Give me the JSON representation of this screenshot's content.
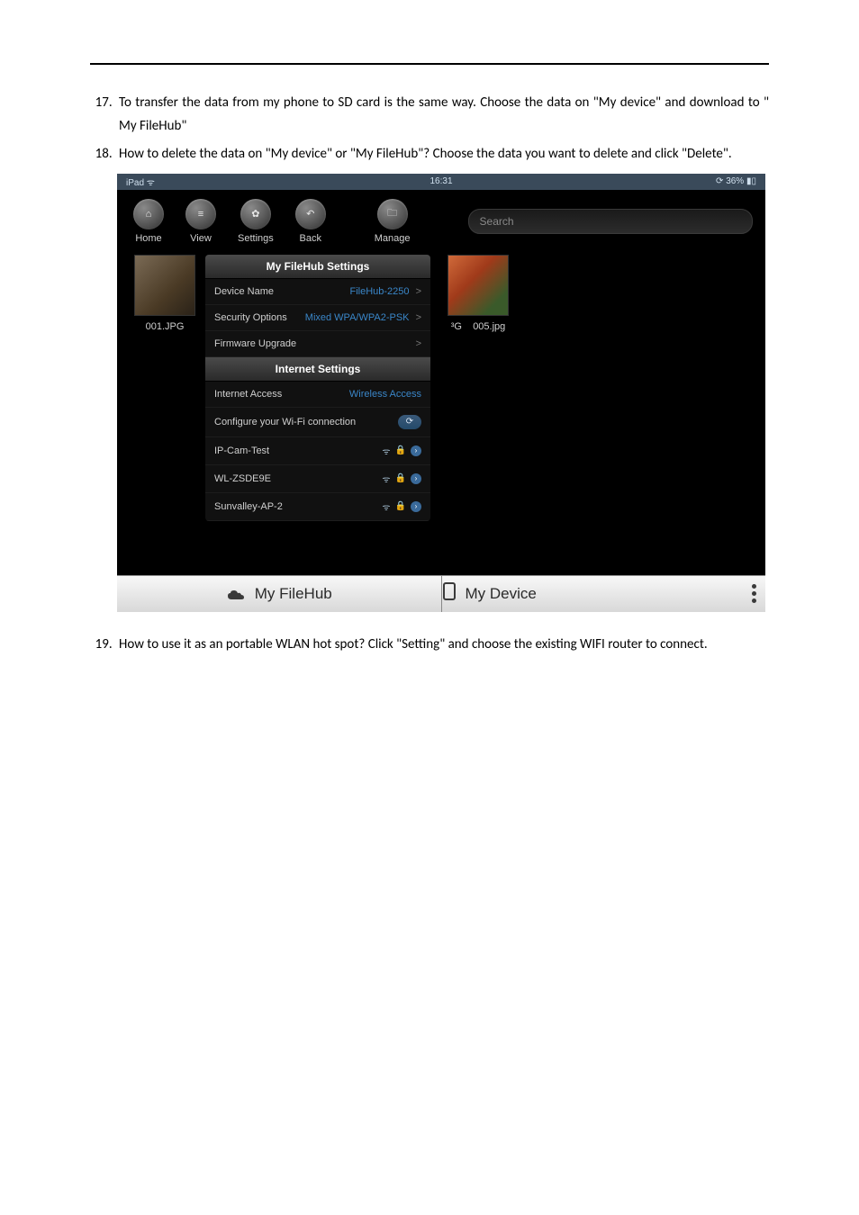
{
  "doc": {
    "item17": "To transfer the data from my phone to SD card is the same way. Choose the data on \"My device\" and download to \" My FileHub\"",
    "item18": "How to delete the data on \"My device\" or \"My FileHub\"? Choose the data you want to delete and click \"Delete\".",
    "item19": "How to use it as an portable WLAN hot spot? Click \"Setting\" and choose the existing WIFI router to connect."
  },
  "statusbar": {
    "left": "iPad",
    "time": "16:31",
    "battery": "36%"
  },
  "toolbar": {
    "home": "Home",
    "view": "View",
    "settings": "Settings",
    "back": "Back",
    "manage": "Manage",
    "search_placeholder": "Search"
  },
  "thumbs": {
    "t1": "001.JPG",
    "t2_prefix": "³G",
    "t2": "005.jpg"
  },
  "panel": {
    "filehub_header": "My FileHub Settings",
    "device_name_label": "Device Name",
    "device_name_value": "FileHub-2250",
    "security_label": "Security Options",
    "security_value": "Mixed WPA/WPA2-PSK",
    "firmware_label": "Firmware Upgrade",
    "internet_header": "Internet Settings",
    "internet_access_label": "Internet Access",
    "internet_access_value": "Wireless Access",
    "configure_label": "Configure your Wi-Fi connection",
    "wifi1": "IP-Cam-Test",
    "wifi2": "WL-ZSDE9E",
    "wifi3": "Sunvalley-AP-2"
  },
  "bottombar": {
    "left": "My FileHub",
    "right": "My Device"
  }
}
